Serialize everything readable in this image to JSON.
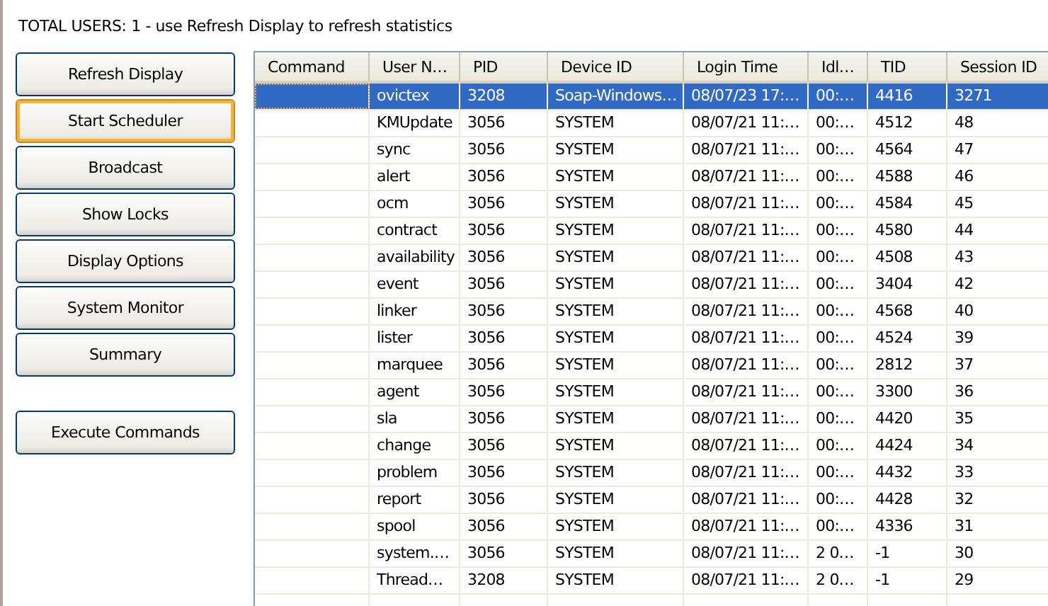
{
  "status_text": "TOTAL USERS:  1 - use Refresh Display to refresh statistics",
  "buttons": [
    {
      "label": "Refresh Display",
      "focused": false
    },
    {
      "label": "Start Scheduler",
      "focused": true
    },
    {
      "label": "Broadcast",
      "focused": false
    },
    {
      "label": "Show Locks",
      "focused": false
    },
    {
      "label": "Display Options",
      "focused": false
    },
    {
      "label": "System Monitor",
      "focused": false
    },
    {
      "label": "Summary",
      "focused": false
    }
  ],
  "execute_button": {
    "label": "Execute Commands"
  },
  "table": {
    "columns": [
      "Command",
      "User N…",
      "PID",
      "Device ID",
      "Login Time",
      "Idl…",
      "TID",
      "Session ID"
    ],
    "rows": [
      {
        "selected": true,
        "cells": [
          "",
          "ovictex",
          "3208",
          "Soap-Windows…",
          "08/07/23 17:…",
          "00:…",
          "4416",
          "3271"
        ]
      },
      {
        "selected": false,
        "cells": [
          "",
          "KMUpdate",
          "3056",
          "SYSTEM",
          "08/07/21 11:…",
          "00:…",
          "4512",
          "48"
        ]
      },
      {
        "selected": false,
        "cells": [
          "",
          "sync",
          "3056",
          "SYSTEM",
          "08/07/21 11:…",
          "00:…",
          "4564",
          "47"
        ]
      },
      {
        "selected": false,
        "cells": [
          "",
          "alert",
          "3056",
          "SYSTEM",
          "08/07/21 11:…",
          "00:…",
          "4588",
          "46"
        ]
      },
      {
        "selected": false,
        "cells": [
          "",
          "ocm",
          "3056",
          "SYSTEM",
          "08/07/21 11:…",
          "00:…",
          "4584",
          "45"
        ]
      },
      {
        "selected": false,
        "cells": [
          "",
          "contract",
          "3056",
          "SYSTEM",
          "08/07/21 11:…",
          "00:…",
          "4580",
          "44"
        ]
      },
      {
        "selected": false,
        "cells": [
          "",
          "availability",
          "3056",
          "SYSTEM",
          "08/07/21 11:…",
          "00:…",
          "4508",
          "43"
        ]
      },
      {
        "selected": false,
        "cells": [
          "",
          "event",
          "3056",
          "SYSTEM",
          "08/07/21 11:…",
          "00:…",
          "3404",
          "42"
        ]
      },
      {
        "selected": false,
        "cells": [
          "",
          "linker",
          "3056",
          "SYSTEM",
          "08/07/21 11:…",
          "00:…",
          "4568",
          "40"
        ]
      },
      {
        "selected": false,
        "cells": [
          "",
          "lister",
          "3056",
          "SYSTEM",
          "08/07/21 11:…",
          "00:…",
          "4524",
          "39"
        ]
      },
      {
        "selected": false,
        "cells": [
          "",
          "marquee",
          "3056",
          "SYSTEM",
          "08/07/21 11:…",
          "00:…",
          "2812",
          "37"
        ]
      },
      {
        "selected": false,
        "cells": [
          "",
          "agent",
          "3056",
          "SYSTEM",
          "08/07/21 11:…",
          "00:…",
          "3300",
          "36"
        ]
      },
      {
        "selected": false,
        "cells": [
          "",
          "sla",
          "3056",
          "SYSTEM",
          "08/07/21 11:…",
          "00:…",
          "4420",
          "35"
        ]
      },
      {
        "selected": false,
        "cells": [
          "",
          "change",
          "3056",
          "SYSTEM",
          "08/07/21 11:…",
          "00:…",
          "4424",
          "34"
        ]
      },
      {
        "selected": false,
        "cells": [
          "",
          "problem",
          "3056",
          "SYSTEM",
          "08/07/21 11:…",
          "00:…",
          "4432",
          "33"
        ]
      },
      {
        "selected": false,
        "cells": [
          "",
          "report",
          "3056",
          "SYSTEM",
          "08/07/21 11:…",
          "00:…",
          "4428",
          "32"
        ]
      },
      {
        "selected": false,
        "cells": [
          "",
          "spool",
          "3056",
          "SYSTEM",
          "08/07/21 11:…",
          "00:…",
          "4336",
          "31"
        ]
      },
      {
        "selected": false,
        "cells": [
          "",
          "system.…",
          "3056",
          "SYSTEM",
          "08/07/21 11:…",
          "2 0…",
          "-1",
          "30"
        ]
      },
      {
        "selected": false,
        "cells": [
          "",
          "Thread…",
          "3208",
          "SYSTEM",
          "08/07/21 11:…",
          "2 0…",
          "-1",
          "29"
        ]
      }
    ]
  }
}
